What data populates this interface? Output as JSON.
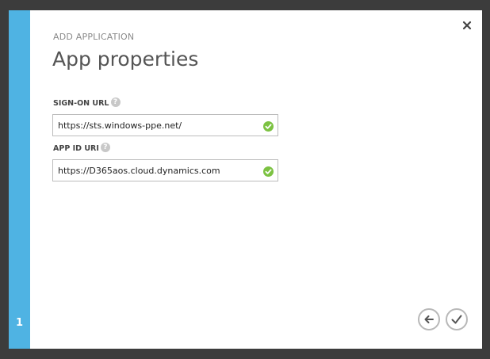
{
  "wizard": {
    "step_number": "1",
    "subtitle": "ADD APPLICATION",
    "title": "App properties",
    "help_glyph": "?",
    "close_icon": "close-icon",
    "back_icon": "back-arrow-icon",
    "complete_icon": "checkmark-icon"
  },
  "fields": {
    "sign_on_url": {
      "label": "SIGN-ON URL",
      "value": "https://sts.windows-ppe.net/",
      "status": "valid"
    },
    "app_id_uri": {
      "label": "APP ID URI",
      "value": "https://D365aos.cloud.dynamics.com",
      "status": "valid"
    }
  },
  "colors": {
    "accent": "#4fb3e3",
    "valid": "#7cc242",
    "frame": "#3c3c3c"
  }
}
